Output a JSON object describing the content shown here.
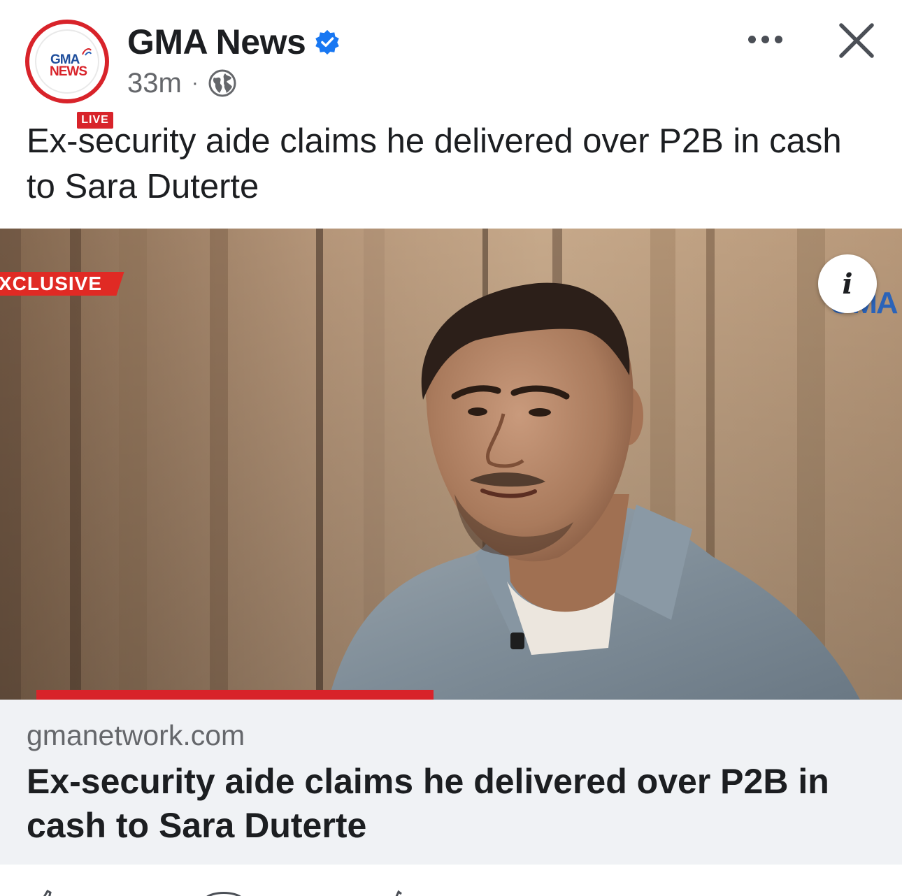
{
  "post": {
    "page_name": "GMA News",
    "verified": true,
    "timestamp": "33m",
    "separator": "·",
    "audience_icon": "globe-icon",
    "caption": "Ex-security aide claims he delivered over P2B in cash to Sara Duterte",
    "avatar": {
      "logo_line1": "GMA",
      "logo_line2": "NEWS",
      "badge": "LIVE"
    }
  },
  "header_actions": {
    "more_icon": "more-horizontal-icon",
    "close_icon": "close-icon"
  },
  "media": {
    "overlay_tag": "XCLUSIVE",
    "watermark": "GMA",
    "info_label": "i"
  },
  "link_preview": {
    "domain": "gmanetwork.com",
    "title": "Ex-security aide claims he delivered over P2B in cash to Sara Duterte"
  },
  "colors": {
    "brand_red": "#d8232a",
    "verified_blue": "#1877f2",
    "link_bg": "#f0f2f5",
    "secondary_text": "#65676b"
  }
}
